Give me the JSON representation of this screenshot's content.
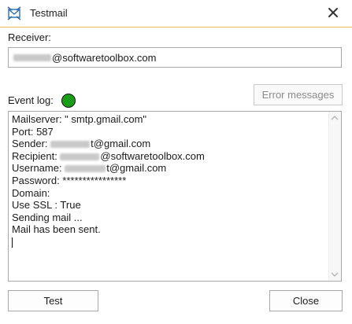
{
  "window": {
    "title": "Testmail",
    "icon": "envelope-arrows-icon",
    "accent_color": "#f0b45a"
  },
  "receiver": {
    "label": "Receiver:",
    "value_domain": "@softwaretoolbox.com"
  },
  "event_log": {
    "label": "Event log:",
    "status_color": "#1a9e1a",
    "error_button_label": "Error messages",
    "lines": {
      "mailserver": "Mailserver: \" smtp.gmail.com\"",
      "port": "Port: 587",
      "sender_prefix": "Sender: ",
      "sender_suffix": "t@gmail.com",
      "recipient_prefix": "Recipient: ",
      "recipient_suffix": "@softwaretoolbox.com",
      "username_prefix": "Username: ",
      "username_suffix": "t@gmail.com",
      "password": "Password: ****************",
      "domain": "Domain:",
      "use_ssl": "Use SSL : True",
      "sending": "Sending mail ...",
      "sent": "Mail has been sent."
    }
  },
  "buttons": {
    "test_label": "Test",
    "close_label": "Close"
  }
}
